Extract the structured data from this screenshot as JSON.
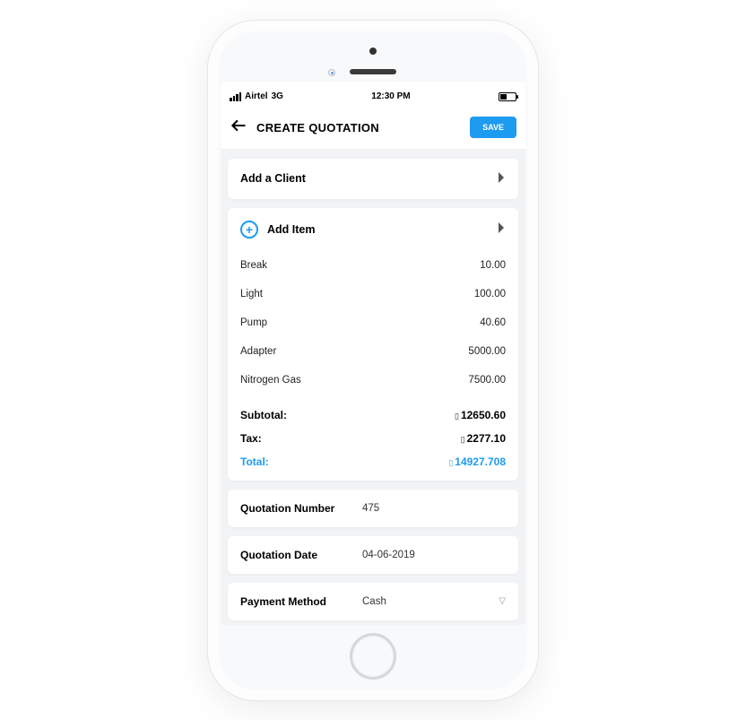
{
  "status": {
    "carrier": "Airtel",
    "network": "3G",
    "time": "12:30 PM"
  },
  "header": {
    "title": "CREATE QUOTATION",
    "save_label": "SAVE"
  },
  "client": {
    "add_label": "Add a Client"
  },
  "items_section": {
    "add_label": "Add Item",
    "items": [
      {
        "name": "Break",
        "price": "10.00"
      },
      {
        "name": "Light",
        "price": "100.00"
      },
      {
        "name": "Pump",
        "price": "40.60"
      },
      {
        "name": "Adapter",
        "price": "5000.00"
      },
      {
        "name": "Nitrogen Gas",
        "price": "7500.00"
      }
    ],
    "subtotal_label": "Subtotal:",
    "subtotal_value": "12650.60",
    "tax_label": "Tax:",
    "tax_value": "2277.10",
    "total_label": "Total:",
    "total_value": "14927.708"
  },
  "fields": {
    "quotation_number_label": "Quotation Number",
    "quotation_number_value": "475",
    "quotation_date_label": "Quotation Date",
    "quotation_date_value": "04-06-2019",
    "payment_method_label": "Payment Method",
    "payment_method_value": "Cash"
  }
}
